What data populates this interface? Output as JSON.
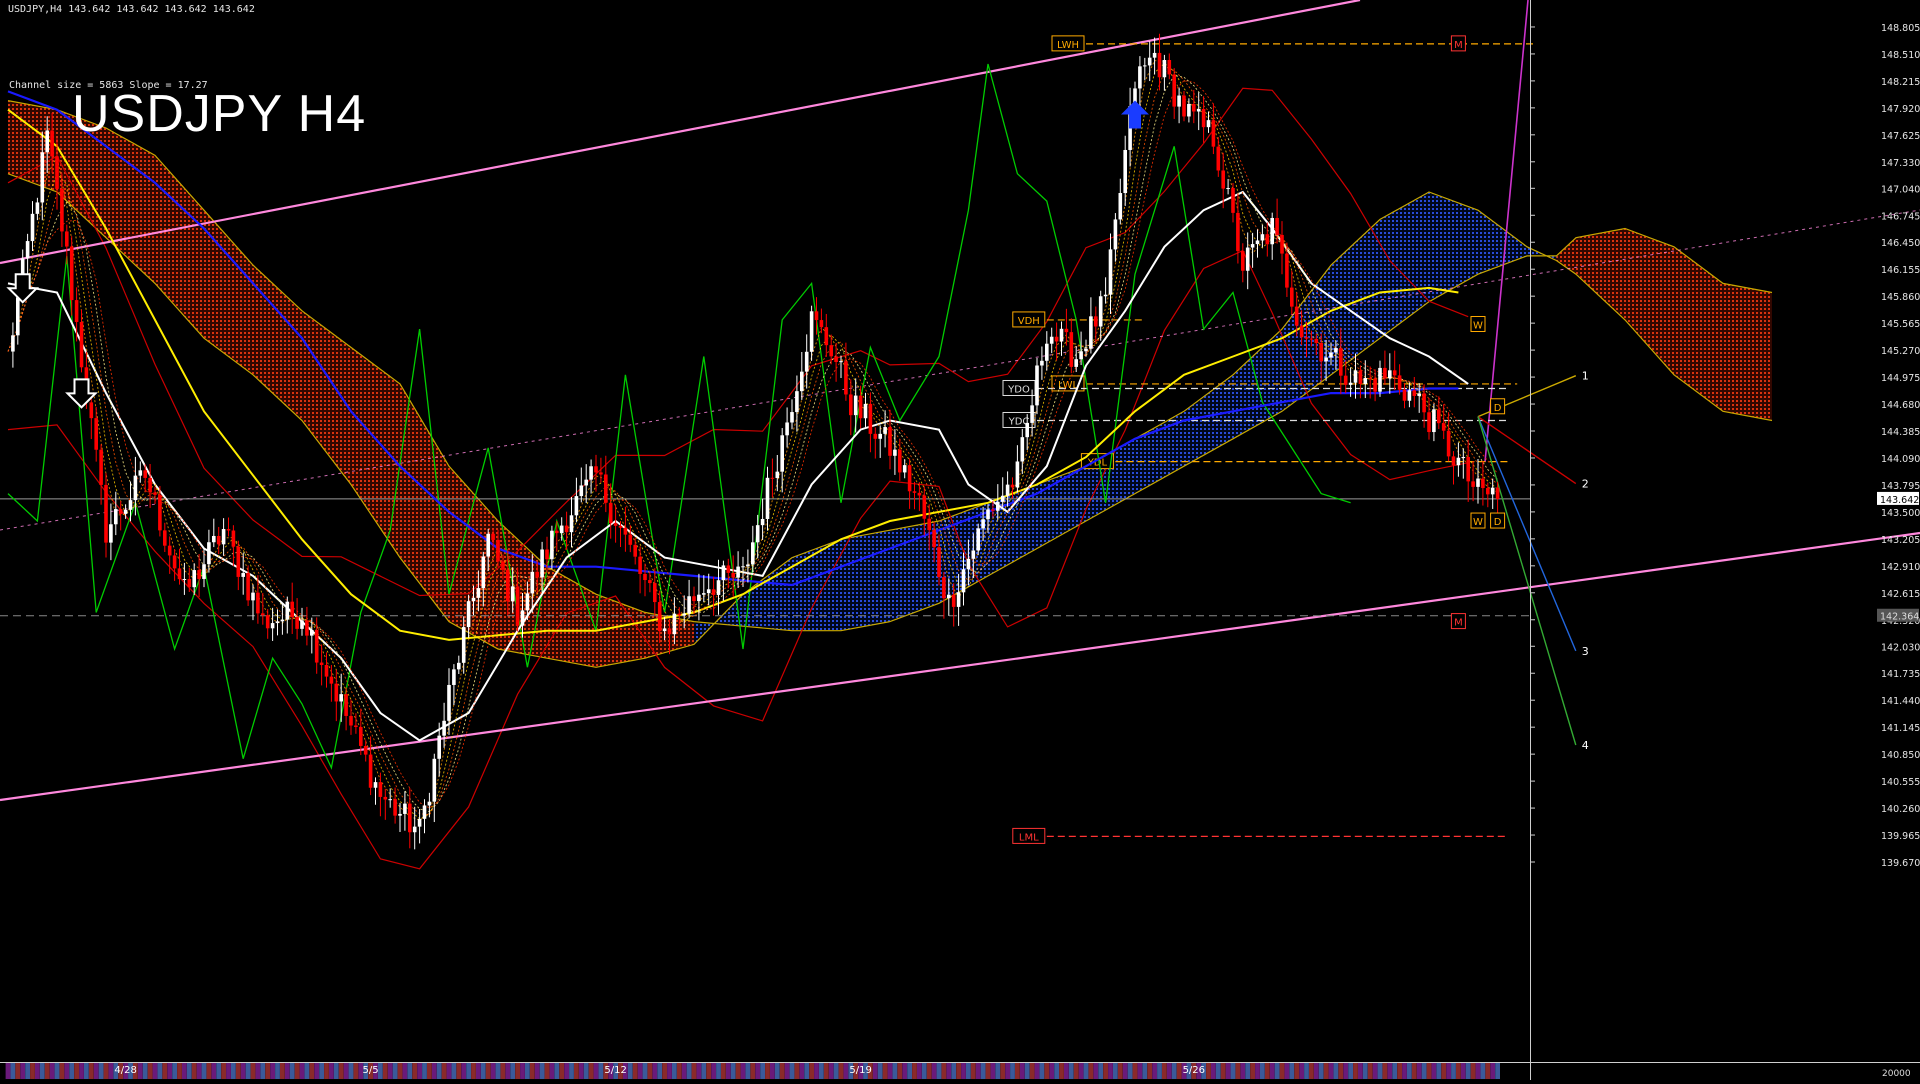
{
  "window": {
    "header": "USDJPY,H4  143.642 143.642 143.642 143.642",
    "big_title": "USDJPY H4",
    "channel_info": "Channel size = 5863 Slope = 17.27"
  },
  "colors": {
    "background": "#000000",
    "bull_candle": "#ffffff",
    "bear_candle": "#ff0000",
    "channel": "#ff88dd",
    "ma_white": "#ffffff",
    "ma_yellow": "#ffee00",
    "ma_blue": "#1a1aff",
    "bollinger": "#cc0000",
    "rsi": "#00cc00",
    "cloud_bear": "#ff3300",
    "cloud_bull": "#3355ff",
    "level_label": "#ffaa00",
    "arrow_blue": "#1a3cff"
  },
  "chart_data": {
    "type": "candlestick",
    "title": "USDJPY H4",
    "ylim": [
      139.67,
      149.1
    ],
    "y_ticks": [
      "148.805",
      "148.510",
      "148.215",
      "147.920",
      "147.625",
      "147.330",
      "147.040",
      "146.745",
      "146.450",
      "146.155",
      "145.860",
      "145.565",
      "145.270",
      "144.975",
      "144.680",
      "144.385",
      "144.090",
      "143.795",
      "143.500",
      "143.205",
      "142.910",
      "142.615",
      "142.320",
      "142.030",
      "141.735",
      "141.440",
      "141.145",
      "140.850",
      "140.555",
      "140.260",
      "139.965",
      "139.670"
    ],
    "y_tick_values": [
      148.805,
      148.51,
      148.215,
      147.92,
      147.625,
      147.33,
      147.04,
      146.745,
      146.45,
      146.155,
      145.86,
      145.565,
      145.27,
      144.975,
      144.68,
      144.385,
      144.09,
      143.795,
      143.5,
      143.205,
      142.91,
      142.615,
      142.32,
      142.03,
      141.735,
      141.44,
      141.145,
      140.85,
      140.555,
      140.26,
      139.965,
      139.67
    ],
    "current_price": "143.642",
    "current_price_value": 143.642,
    "dashed_level_label": "142.364",
    "dashed_level_value": 142.364,
    "x_labels": [
      {
        "label": "4/28",
        "bar": 24
      },
      {
        "label": "5/5",
        "bar": 74
      },
      {
        "label": "5/12",
        "bar": 124
      },
      {
        "label": "5/19",
        "bar": 174
      },
      {
        "label": "5/26",
        "bar": 242
      }
    ],
    "volume_label": "20000",
    "levels": [
      {
        "label": "LWH",
        "value": 148.62,
        "color": "#ffaa00",
        "from_bar": 220,
        "to_bar": 312
      },
      {
        "label": "VDH",
        "value": 145.6,
        "color": "#ffaa00",
        "from_bar": 212,
        "to_bar": 232
      },
      {
        "label": "LWL",
        "value": 144.9,
        "color": "#ffaa00",
        "from_bar": 220,
        "to_bar": 308
      },
      {
        "label": "YDO",
        "value": 144.85,
        "color": "#dddddd",
        "from_bar": 210,
        "to_bar": 306
      },
      {
        "label": "YDC",
        "value": 144.5,
        "color": "#dddddd",
        "from_bar": 210,
        "to_bar": 306
      },
      {
        "label": "YDL",
        "value": 144.05,
        "color": "#ffaa00",
        "from_bar": 226,
        "to_bar": 306
      },
      {
        "label": "LML",
        "value": 139.95,
        "color": "#ff3333",
        "from_bar": 212,
        "to_bar": 306
      }
    ],
    "box_markers": [
      {
        "label": "M",
        "value": 148.62,
        "bar": 296,
        "color": "#ff3333"
      },
      {
        "label": "M",
        "value": 142.3,
        "bar": 296,
        "color": "#ff3333"
      },
      {
        "label": "W",
        "value": 145.55,
        "bar": 300,
        "color": "#ffaa00"
      },
      {
        "label": "D",
        "value": 144.65,
        "bar": 304,
        "color": "#ffaa00"
      },
      {
        "label": "W",
        "value": 143.4,
        "bar": 300,
        "color": "#ffaa00"
      },
      {
        "label": "D",
        "value": 143.4,
        "bar": 304,
        "color": "#ffaa00"
      }
    ],
    "projection_labels": [
      {
        "label": "1",
        "value": 144.99,
        "bar": 322
      },
      {
        "label": "2",
        "value": 143.81,
        "bar": 322
      },
      {
        "label": "3",
        "value": 141.98,
        "bar": 322
      },
      {
        "label": "4",
        "value": 140.95,
        "bar": 322
      }
    ],
    "anchors": [
      {
        "bar": 0,
        "price": 145.2
      },
      {
        "bar": 8,
        "price": 147.6
      },
      {
        "bar": 12,
        "price": 146.3
      },
      {
        "bar": 20,
        "price": 143.3
      },
      {
        "bar": 28,
        "price": 143.9
      },
      {
        "bar": 36,
        "price": 142.6
      },
      {
        "bar": 44,
        "price": 143.3
      },
      {
        "bar": 52,
        "price": 142.3
      },
      {
        "bar": 60,
        "price": 142.4
      },
      {
        "bar": 68,
        "price": 141.4
      },
      {
        "bar": 76,
        "price": 140.4
      },
      {
        "bar": 84,
        "price": 140.0
      },
      {
        "bar": 90,
        "price": 141.5
      },
      {
        "bar": 98,
        "price": 143.2
      },
      {
        "bar": 104,
        "price": 142.4
      },
      {
        "bar": 112,
        "price": 143.3
      },
      {
        "bar": 120,
        "price": 143.9
      },
      {
        "bar": 126,
        "price": 143.2
      },
      {
        "bar": 134,
        "price": 142.2
      },
      {
        "bar": 142,
        "price": 142.7
      },
      {
        "bar": 150,
        "price": 142.8
      },
      {
        "bar": 158,
        "price": 144.3
      },
      {
        "bar": 164,
        "price": 145.6
      },
      {
        "bar": 168,
        "price": 145.3
      },
      {
        "bar": 172,
        "price": 144.7
      },
      {
        "bar": 180,
        "price": 144.2
      },
      {
        "bar": 186,
        "price": 143.6
      },
      {
        "bar": 192,
        "price": 142.5
      },
      {
        "bar": 200,
        "price": 143.5
      },
      {
        "bar": 206,
        "price": 143.9
      },
      {
        "bar": 212,
        "price": 145.5
      },
      {
        "bar": 218,
        "price": 145.2
      },
      {
        "bar": 224,
        "price": 145.8
      },
      {
        "bar": 230,
        "price": 148.2
      },
      {
        "bar": 234,
        "price": 148.5
      },
      {
        "bar": 240,
        "price": 147.9
      },
      {
        "bar": 246,
        "price": 147.6
      },
      {
        "bar": 252,
        "price": 146.2
      },
      {
        "bar": 258,
        "price": 146.6
      },
      {
        "bar": 264,
        "price": 145.5
      },
      {
        "bar": 270,
        "price": 145.2
      },
      {
        "bar": 276,
        "price": 144.9
      },
      {
        "bar": 282,
        "price": 145.0
      },
      {
        "bar": 288,
        "price": 144.7
      },
      {
        "bar": 294,
        "price": 144.2
      },
      {
        "bar": 300,
        "price": 143.7
      }
    ],
    "ma_white": [
      [
        0,
        146.0
      ],
      [
        10,
        145.9
      ],
      [
        20,
        144.8
      ],
      [
        30,
        143.8
      ],
      [
        40,
        143.1
      ],
      [
        50,
        142.8
      ],
      [
        60,
        142.3
      ],
      [
        68,
        141.9
      ],
      [
        76,
        141.3
      ],
      [
        84,
        141.0
      ],
      [
        94,
        141.3
      ],
      [
        104,
        142.2
      ],
      [
        114,
        143.0
      ],
      [
        124,
        143.4
      ],
      [
        134,
        143.0
      ],
      [
        144,
        142.9
      ],
      [
        154,
        142.8
      ],
      [
        164,
        143.8
      ],
      [
        174,
        144.4
      ],
      [
        180,
        144.5
      ],
      [
        190,
        144.4
      ],
      [
        196,
        143.8
      ],
      [
        204,
        143.5
      ],
      [
        212,
        144.0
      ],
      [
        220,
        145.1
      ],
      [
        228,
        145.7
      ],
      [
        236,
        146.4
      ],
      [
        244,
        146.8
      ],
      [
        252,
        147.0
      ],
      [
        258,
        146.6
      ],
      [
        266,
        146.0
      ],
      [
        274,
        145.7
      ],
      [
        282,
        145.4
      ],
      [
        290,
        145.2
      ],
      [
        298,
        144.9
      ]
    ],
    "ma_yellow": [
      [
        0,
        147.9
      ],
      [
        10,
        147.5
      ],
      [
        20,
        146.6
      ],
      [
        30,
        145.6
      ],
      [
        40,
        144.6
      ],
      [
        50,
        143.9
      ],
      [
        60,
        143.2
      ],
      [
        70,
        142.6
      ],
      [
        80,
        142.2
      ],
      [
        90,
        142.1
      ],
      [
        100,
        142.15
      ],
      [
        110,
        142.2
      ],
      [
        120,
        142.2
      ],
      [
        130,
        142.3
      ],
      [
        140,
        142.4
      ],
      [
        150,
        142.6
      ],
      [
        160,
        142.9
      ],
      [
        170,
        143.2
      ],
      [
        180,
        143.4
      ],
      [
        190,
        143.5
      ],
      [
        200,
        143.6
      ],
      [
        210,
        143.8
      ],
      [
        220,
        144.1
      ],
      [
        230,
        144.6
      ],
      [
        240,
        145.0
      ],
      [
        250,
        145.2
      ],
      [
        260,
        145.4
      ],
      [
        270,
        145.7
      ],
      [
        280,
        145.9
      ],
      [
        290,
        145.95
      ],
      [
        296,
        145.9
      ]
    ],
    "ma_blue": [
      [
        0,
        148.1
      ],
      [
        10,
        147.9
      ],
      [
        20,
        147.5
      ],
      [
        30,
        147.1
      ],
      [
        40,
        146.6
      ],
      [
        50,
        146.0
      ],
      [
        60,
        145.4
      ],
      [
        70,
        144.6
      ],
      [
        80,
        144.0
      ],
      [
        90,
        143.5
      ],
      [
        100,
        143.1
      ],
      [
        110,
        142.9
      ],
      [
        120,
        142.9
      ],
      [
        130,
        142.85
      ],
      [
        140,
        142.8
      ],
      [
        150,
        142.75
      ],
      [
        160,
        142.7
      ],
      [
        170,
        142.9
      ],
      [
        180,
        143.1
      ],
      [
        190,
        143.3
      ],
      [
        200,
        143.5
      ],
      [
        210,
        143.7
      ],
      [
        220,
        144.0
      ],
      [
        230,
        144.3
      ],
      [
        240,
        144.5
      ],
      [
        250,
        144.6
      ],
      [
        260,
        144.7
      ],
      [
        270,
        144.8
      ],
      [
        280,
        144.8
      ],
      [
        290,
        144.85
      ],
      [
        296,
        144.85
      ]
    ],
    "cloud": [
      [
        0,
        148.0,
        147.2
      ],
      [
        10,
        147.9,
        147.0
      ],
      [
        20,
        147.7,
        146.5
      ],
      [
        30,
        147.4,
        146.0
      ],
      [
        40,
        146.8,
        145.4
      ],
      [
        50,
        146.2,
        145.0
      ],
      [
        60,
        145.7,
        144.5
      ],
      [
        70,
        145.3,
        143.8
      ],
      [
        80,
        144.9,
        143.0
      ],
      [
        90,
        144.0,
        142.3
      ],
      [
        100,
        143.4,
        142.0
      ],
      [
        110,
        142.9,
        141.9
      ],
      [
        120,
        142.6,
        141.8
      ],
      [
        130,
        142.4,
        141.9
      ],
      [
        140,
        142.3,
        142.05
      ],
      [
        150,
        142.25,
        142.6
      ],
      [
        160,
        142.2,
        143.0
      ],
      [
        170,
        142.2,
        143.2
      ],
      [
        180,
        142.3,
        143.3
      ],
      [
        190,
        142.5,
        143.4
      ],
      [
        200,
        142.8,
        143.6
      ],
      [
        210,
        143.1,
        143.8
      ],
      [
        220,
        143.4,
        144.0
      ],
      [
        230,
        143.7,
        144.3
      ],
      [
        240,
        144.0,
        144.6
      ],
      [
        250,
        144.3,
        145.0
      ],
      [
        260,
        144.6,
        145.5
      ],
      [
        270,
        145.0,
        146.2
      ],
      [
        280,
        145.4,
        146.7
      ],
      [
        290,
        145.8,
        147.0
      ],
      [
        300,
        146.1,
        146.8
      ],
      [
        310,
        146.3,
        146.4
      ],
      [
        316,
        146.3,
        146.25
      ],
      [
        320,
        146.5,
        146.1
      ],
      [
        330,
        146.6,
        145.6
      ],
      [
        340,
        146.4,
        145.0
      ],
      [
        350,
        146.0,
        144.6
      ],
      [
        360,
        145.9,
        144.5
      ]
    ],
    "rsi": [
      [
        0,
        143.7
      ],
      [
        6,
        143.4
      ],
      [
        12,
        146.3
      ],
      [
        18,
        142.4
      ],
      [
        26,
        143.6
      ],
      [
        34,
        142.0
      ],
      [
        40,
        142.9
      ],
      [
        48,
        140.8
      ],
      [
        54,
        141.9
      ],
      [
        60,
        141.4
      ],
      [
        66,
        140.7
      ],
      [
        72,
        142.4
      ],
      [
        78,
        143.3
      ],
      [
        84,
        145.5
      ],
      [
        90,
        142.6
      ],
      [
        98,
        144.2
      ],
      [
        106,
        141.8
      ],
      [
        112,
        143.4
      ],
      [
        120,
        142.2
      ],
      [
        126,
        145.0
      ],
      [
        134,
        142.4
      ],
      [
        142,
        145.2
      ],
      [
        150,
        142.0
      ],
      [
        158,
        145.6
      ],
      [
        164,
        146.0
      ],
      [
        170,
        143.6
      ],
      [
        176,
        145.3
      ],
      [
        182,
        144.5
      ],
      [
        190,
        145.2
      ],
      [
        196,
        146.8
      ],
      [
        200,
        148.4
      ],
      [
        206,
        147.2
      ],
      [
        212,
        146.9
      ],
      [
        218,
        145.6
      ],
      [
        224,
        143.6
      ],
      [
        230,
        146.1
      ],
      [
        238,
        147.5
      ],
      [
        244,
        145.5
      ],
      [
        250,
        145.9
      ],
      [
        256,
        144.7
      ],
      [
        262,
        144.2
      ],
      [
        268,
        143.7
      ],
      [
        274,
        143.6
      ]
    ]
  }
}
